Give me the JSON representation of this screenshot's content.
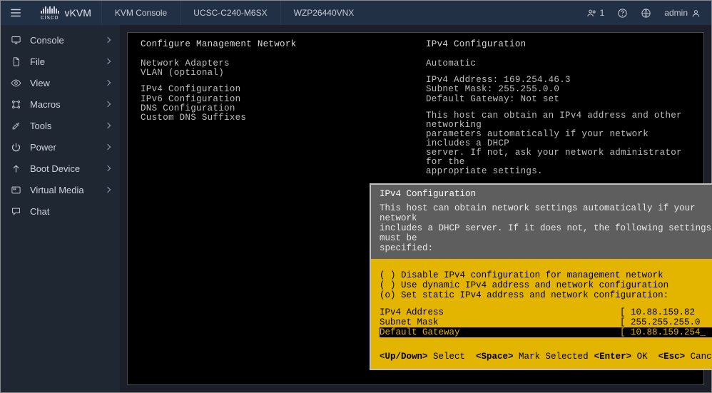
{
  "topbar": {
    "brand_small": "cisco",
    "brand": "vKVM",
    "crumbs": [
      "KVM Console",
      "UCSC-C240-M6SX",
      "WZP26440VNX"
    ],
    "user_count": "1",
    "username": "admin"
  },
  "sidebar": {
    "items": [
      {
        "label": "Console"
      },
      {
        "label": "File"
      },
      {
        "label": "View"
      },
      {
        "label": "Macros"
      },
      {
        "label": "Tools"
      },
      {
        "label": "Power"
      },
      {
        "label": "Boot Device"
      },
      {
        "label": "Virtual Media"
      },
      {
        "label": "Chat"
      }
    ]
  },
  "console": {
    "left_header": "Configure Management Network",
    "right_header": "IPv4 Configuration",
    "left_block1": [
      "Network Adapters",
      "VLAN (optional)"
    ],
    "left_block2": [
      "IPv4 Configuration",
      "IPv6 Configuration",
      "DNS Configuration",
      "Custom DNS Suffixes"
    ],
    "right_block1": [
      "Automatic"
    ],
    "right_block2": [
      "IPv4 Address: 169.254.46.3",
      "Subnet Mask: 255.255.0.0",
      "Default Gateway: Not set"
    ],
    "right_block3": [
      "This host can obtain an IPv4 address and other networking",
      "parameters automatically if your network includes a DHCP",
      "server. If not, ask your network administrator for the",
      "appropriate settings."
    ]
  },
  "dialog": {
    "title": "IPv4 Configuration",
    "intro": [
      "This host can obtain network settings automatically if your network",
      "includes a DHCP server. If it does not, the following settings must be",
      "specified:"
    ],
    "options": [
      {
        "mark": " ",
        "text": "Disable IPv4 configuration for management network"
      },
      {
        "mark": " ",
        "text": "Use dynamic IPv4 address and network configuration"
      },
      {
        "mark": "o",
        "text": "Set static IPv4 address and network configuration:"
      }
    ],
    "fields": [
      {
        "label": "IPv4 Address",
        "value": "10.88.159.82",
        "selected": false
      },
      {
        "label": "Subnet Mask",
        "value": "255.255.255.0",
        "selected": false
      },
      {
        "label": "Default Gateway",
        "value": "10.88.159.254_",
        "selected": true
      }
    ],
    "footer": {
      "k1": "<Up/Down>",
      "a1": " Select  ",
      "k2": "<Space>",
      "a2": " Mark Selected",
      "k3": "<Enter>",
      "a3": " OK  ",
      "k4": "<Esc>",
      "a4": " Cancel"
    }
  }
}
